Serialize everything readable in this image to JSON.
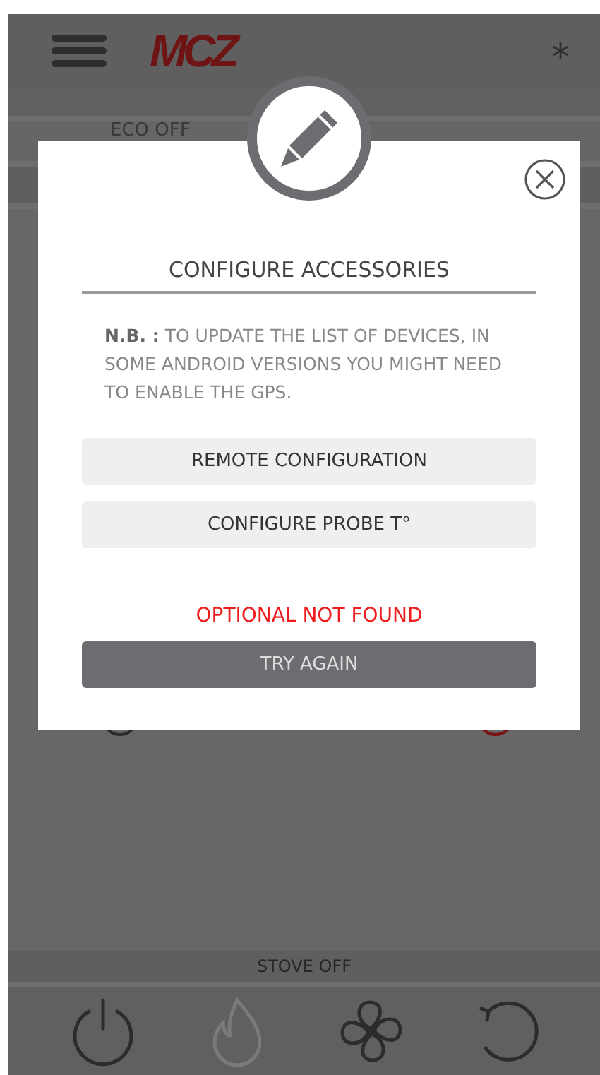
{
  "header": {
    "logo": "MCZ"
  },
  "status_row": {
    "label": "ECO OFF"
  },
  "dialog": {
    "title": "CONFIGURE ACCESSORIES",
    "note": "**N.B. :** TO UPDATE THE LIST OF DEVICES, IN SOME ANDROID VERSIONS YOU MIGHT NEED TO ENABLE THE GPS.",
    "options": [
      "REMOTE CONFIGURATION",
      "CONFIGURE PROBE T°"
    ],
    "error": "OPTIONAL NOT FOUND",
    "retry": "TRY AGAIN"
  },
  "stove_status": "STOVE OFF",
  "bottom_bar": [
    {
      "kind": "power",
      "disabled": false
    },
    {
      "kind": "flame",
      "disabled": true
    },
    {
      "kind": "fan",
      "disabled": false
    },
    {
      "kind": "reset",
      "disabled": false
    }
  ]
}
